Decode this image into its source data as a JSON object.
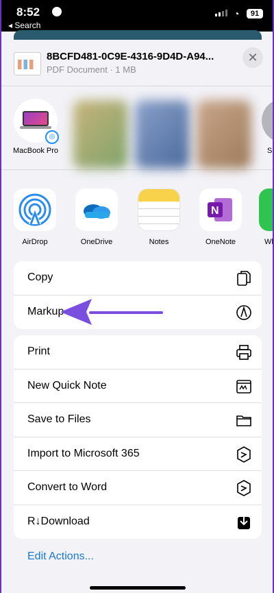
{
  "status_bar": {
    "time": "8:52",
    "back_label": "◂ Search",
    "battery": "91"
  },
  "file": {
    "name": "8BCFD481-0C9E-4316-9D4D-A94...",
    "meta": "PDF Document · 1 MB"
  },
  "close_glyph": "✕",
  "people": [
    {
      "label": "MacBook Pro"
    },
    {
      "label": "Sa"
    }
  ],
  "apps": [
    {
      "label": "AirDrop",
      "icon": "airdrop-icon"
    },
    {
      "label": "OneDrive",
      "icon": "onedrive-icon"
    },
    {
      "label": "Notes",
      "icon": "notes-icon"
    },
    {
      "label": "OneNote",
      "icon": "onenote-icon"
    },
    {
      "label": "Wh",
      "icon": "whatsapp-icon"
    }
  ],
  "actions_group1": [
    {
      "label": "Copy",
      "icon": "copy-icon"
    },
    {
      "label": "Markup",
      "icon": "markup-icon"
    }
  ],
  "actions_group2": [
    {
      "label": "Print",
      "icon": "print-icon"
    },
    {
      "label": "New Quick Note",
      "icon": "quick-note-icon"
    },
    {
      "label": "Save to Files",
      "icon": "folder-icon"
    },
    {
      "label": "Import to Microsoft 365",
      "icon": "microsoft-365-icon"
    },
    {
      "label": "Convert to Word",
      "icon": "microsoft-365-icon"
    },
    {
      "label": "R↓Download",
      "icon": "download-icon"
    }
  ],
  "edit_actions": "Edit Actions...",
  "colors": {
    "accent": "#1a78d6",
    "arrow": "#7a4fe0",
    "frame": "#6a2fc4"
  }
}
